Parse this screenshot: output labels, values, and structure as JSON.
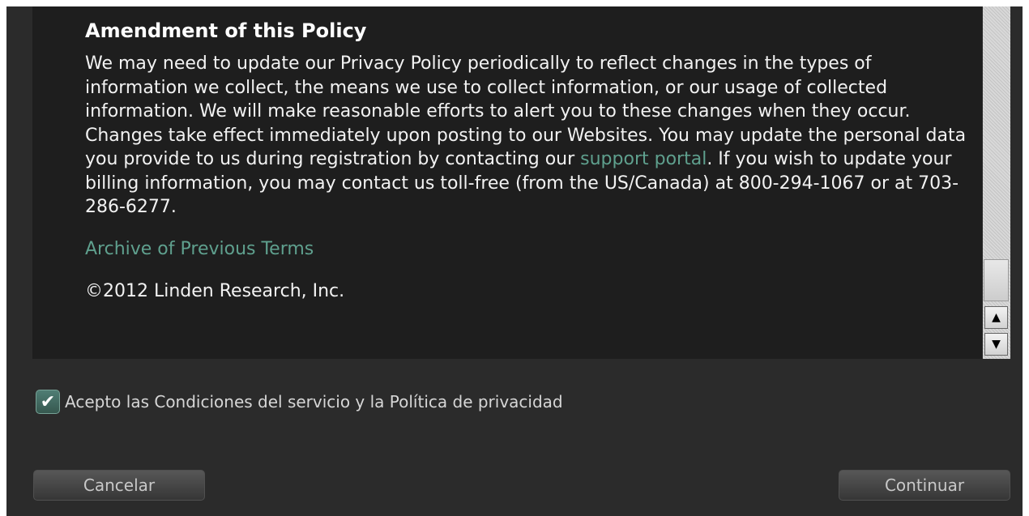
{
  "document": {
    "heading": "Amendment of this Policy",
    "paragraph_before_link": "We may need to update our Privacy Policy periodically to reflect changes in the types of information we collect, the means we use to collect information, or our usage of collected information. We will make reasonable efforts to alert you to these changes when they occur. Changes take effect immediately upon posting to our Websites. You may update the personal data you provide to us during registration by contacting our ",
    "support_link": "support portal",
    "paragraph_after_link": ". If you wish to update your billing information, you may contact us toll-free (from the US/Canada) at 800-294-1067 or at 703-286-6277.",
    "archive_link": "Archive of Previous Terms",
    "copyright": "©2012 Linden Research, Inc."
  },
  "consent": {
    "checked": true,
    "checkmark": "✔",
    "label": "Acepto las Condiciones del servicio y la Política de privacidad"
  },
  "buttons": {
    "cancel": "Cancelar",
    "continue": "Continuar"
  },
  "scrollbar": {
    "up_arrow": "▲",
    "down_arrow": "▼"
  },
  "colors": {
    "link": "#5fa08e",
    "background": "#2b2b2b",
    "document_background": "#1e1e1e"
  }
}
